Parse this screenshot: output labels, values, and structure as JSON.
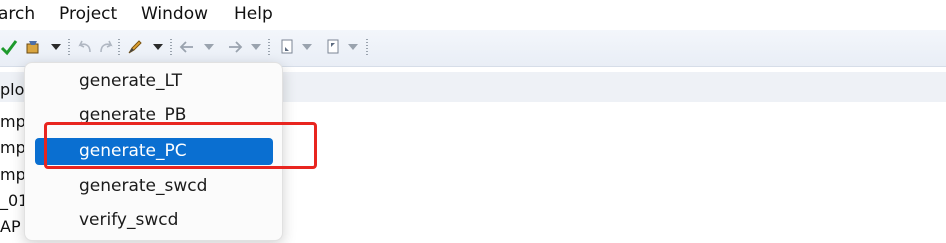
{
  "menubar": {
    "items": [
      "arch",
      "Project",
      "Window",
      "Help"
    ]
  },
  "toolbar": {
    "icons": [
      "check-icon",
      "build-icon",
      "undo-icon",
      "redo-icon",
      "pen-icon",
      "back-arrow-icon",
      "forward-arrow-icon",
      "next-annotation-icon",
      "prev-annotation-icon"
    ]
  },
  "editor": {
    "lines": [
      "plo",
      "mp",
      "mp",
      "mp",
      "_01",
      "AP"
    ]
  },
  "dropdown": {
    "items": [
      {
        "label": "generate_LT",
        "selected": false
      },
      {
        "label": "generate_PB",
        "selected": false
      },
      {
        "label": "generate_PC",
        "selected": true
      },
      {
        "label": "generate_swcd",
        "selected": false
      },
      {
        "label": "verify_swcd",
        "selected": false
      }
    ]
  },
  "colors": {
    "selection": "#0a6fd1",
    "annotation": "#e8251f"
  }
}
